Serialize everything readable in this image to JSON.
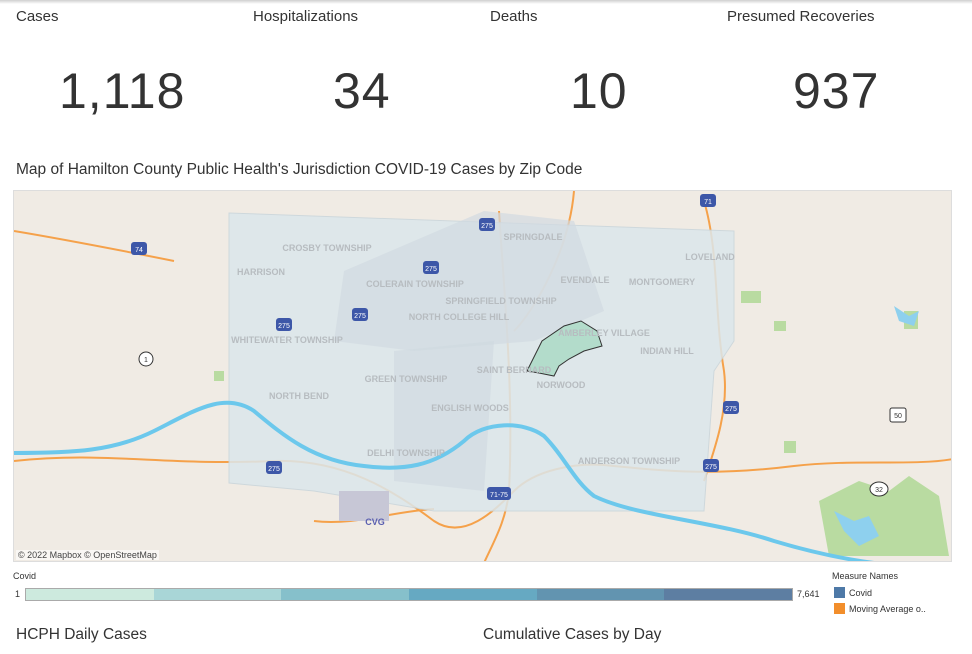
{
  "kpis": [
    {
      "label": "Cases",
      "value": "1,118"
    },
    {
      "label": "Hospitalizations",
      "value": "34"
    },
    {
      "label": "Deaths",
      "value": "10"
    },
    {
      "label": "Presumed Recoveries",
      "value": "937"
    }
  ],
  "map": {
    "title": "Map of Hamilton County Public Health's Jurisdiction COVID-19 Cases by Zip Code",
    "attribution": "© 2022 Mapbox  © OpenStreetMap",
    "places": [
      "CROSBY TOWNSHIP",
      "HARRISON",
      "COLERAIN TOWNSHIP",
      "SPRINGDALE",
      "SPRINGFIELD TOWNSHIP",
      "NORTH COLLEGE HILL",
      "EVENDALE",
      "MONTGOMERY",
      "LOVELAND",
      "WHITEWATER TOWNSHIP",
      "GREEN TOWNSHIP",
      "SAINT BERNARD",
      "NORWOOD",
      "AMBERLEY VILLAGE",
      "INDIAN HILL",
      "NORTH BEND",
      "ENGLISH WOODS",
      "DELHI TOWNSHIP",
      "ANDERSON TOWNSHIP",
      "CVG"
    ],
    "shields": [
      "74",
      "275",
      "275",
      "275",
      "275",
      "275",
      "275",
      "275",
      "71",
      "71-75",
      "50",
      "32",
      "1"
    ]
  },
  "color_legend": {
    "title": "Covid",
    "min": "1",
    "max": "7,641",
    "colors": [
      "#cdeade",
      "#a9d6d7",
      "#86c0cb",
      "#66a9c2",
      "#6294b0",
      "#5d7ea2"
    ]
  },
  "measure_legend": {
    "title": "Measure Names",
    "items": [
      {
        "label": "Covid",
        "color": "#4e79a7"
      },
      {
        "label": "Moving Average o..",
        "color": "#f28e2b"
      }
    ]
  },
  "sections": {
    "daily": "HCPH Daily Cases",
    "cumulative": "Cumulative Cases by Day"
  }
}
